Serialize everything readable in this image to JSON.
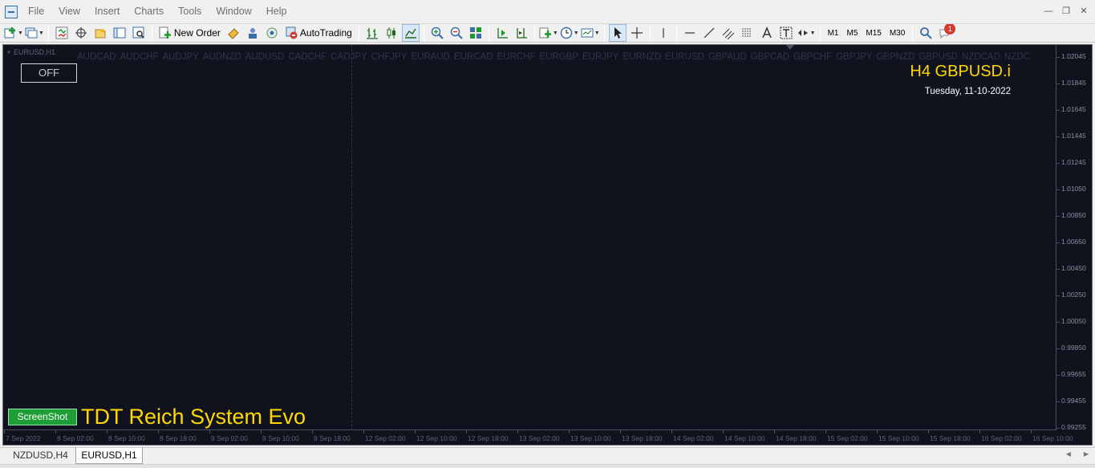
{
  "menu": {
    "items": [
      "File",
      "View",
      "Insert",
      "Charts",
      "Tools",
      "Window",
      "Help"
    ]
  },
  "toolbar": {
    "new_order_label": "New Order",
    "autotrading_label": "AutoTrading",
    "timeframes": [
      "M1",
      "M5",
      "M15",
      "M30"
    ],
    "notification_count": "1"
  },
  "chart": {
    "window_label": "EURUSD,H1",
    "pairs": [
      "AUDCAD",
      "AUDCHF",
      "AUDJPY",
      "AUDNZD",
      "AUDUSD",
      "CADCHF",
      "CADJPY",
      "CHFJPY",
      "EURAUD",
      "EURCAD",
      "EURCHF",
      "EURGBP",
      "EURJPY",
      "EURNZD",
      "EURUSD",
      "GBPAUD",
      "GBPCAD",
      "GBPCHF",
      "GBPJPY",
      "GBPNZD",
      "GBPUSD",
      "NZDCAD",
      "NZDC"
    ],
    "off_button_label": "OFF",
    "timeframe_symbol": "H4 GBPUSD.i",
    "date": "Tuesday, 11-10-2022",
    "screenshot_button_label": "ScreenShot",
    "system_title": "TDT Reich System Evo",
    "y_axis_labels": [
      "1.02045",
      "1.01845",
      "1.01645",
      "1.01445",
      "1.01245",
      "1.01050",
      "1.00850",
      "1.00650",
      "1.00450",
      "1.00250",
      "1.00050",
      "0.99850",
      "0.99655",
      "0.99455",
      "0.99255"
    ],
    "x_axis_labels": [
      "7 Sep 2022",
      "8 Sep 02:00",
      "8 Sep 10:00",
      "8 Sep 18:00",
      "9 Sep 02:00",
      "9 Sep 10:00",
      "9 Sep 18:00",
      "12 Sep 02:00",
      "12 Sep 10:00",
      "12 Sep 18:00",
      "13 Sep 02:00",
      "13 Sep 10:00",
      "13 Sep 18:00",
      "14 Sep 02:00",
      "14 Sep 10:00",
      "14 Sep 18:00",
      "15 Sep 02:00",
      "15 Sep 10:00",
      "15 Sep 18:00",
      "16 Sep 02:00",
      "16 Sep 10:00"
    ],
    "colors": {
      "background": "#10131e",
      "title": "#ffd800",
      "screenshot_button": "#1d9e36"
    }
  },
  "tabs": [
    {
      "label": "NZDUSD,H4",
      "active": false
    },
    {
      "label": "EURUSD,H1",
      "active": true
    }
  ]
}
